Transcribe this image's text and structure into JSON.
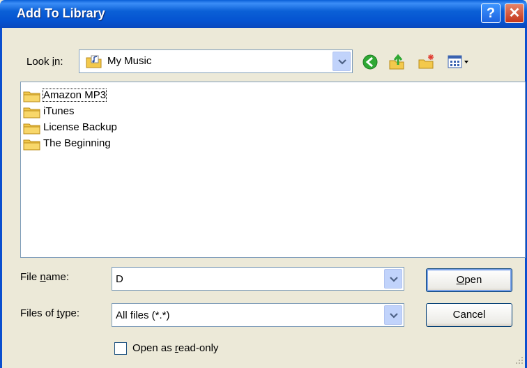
{
  "window": {
    "title": "Add To Library",
    "help_glyph": "?",
    "close_glyph": "✕"
  },
  "lookin": {
    "label_pre": "Look ",
    "label_key": "i",
    "label_post": "n:",
    "value": "My Music"
  },
  "toolbar": {
    "icons": [
      "back-icon",
      "up-folder-icon",
      "new-folder-icon",
      "view-menu-icon"
    ]
  },
  "files": [
    {
      "name": "Amazon MP3"
    },
    {
      "name": "iTunes"
    },
    {
      "name": "License Backup"
    },
    {
      "name": "The Beginning"
    }
  ],
  "filename": {
    "label_pre": "File ",
    "label_key": "n",
    "label_post": "ame:",
    "value": "D"
  },
  "filetype": {
    "label_pre": "Files of ",
    "label_key": "t",
    "label_post": "ype:",
    "value": "All files (*.*)"
  },
  "buttons": {
    "open_key": "O",
    "open_rest": "pen",
    "cancel": "Cancel"
  },
  "readonly": {
    "label_pre": "Open as ",
    "label_key": "r",
    "label_post": "ead-only",
    "checked": false
  },
  "colors": {
    "titlebar": "#0553D1",
    "dialog_bg": "#ECE9D8",
    "folder": "#F3C94C",
    "combo_border": "#7F9DB9"
  }
}
